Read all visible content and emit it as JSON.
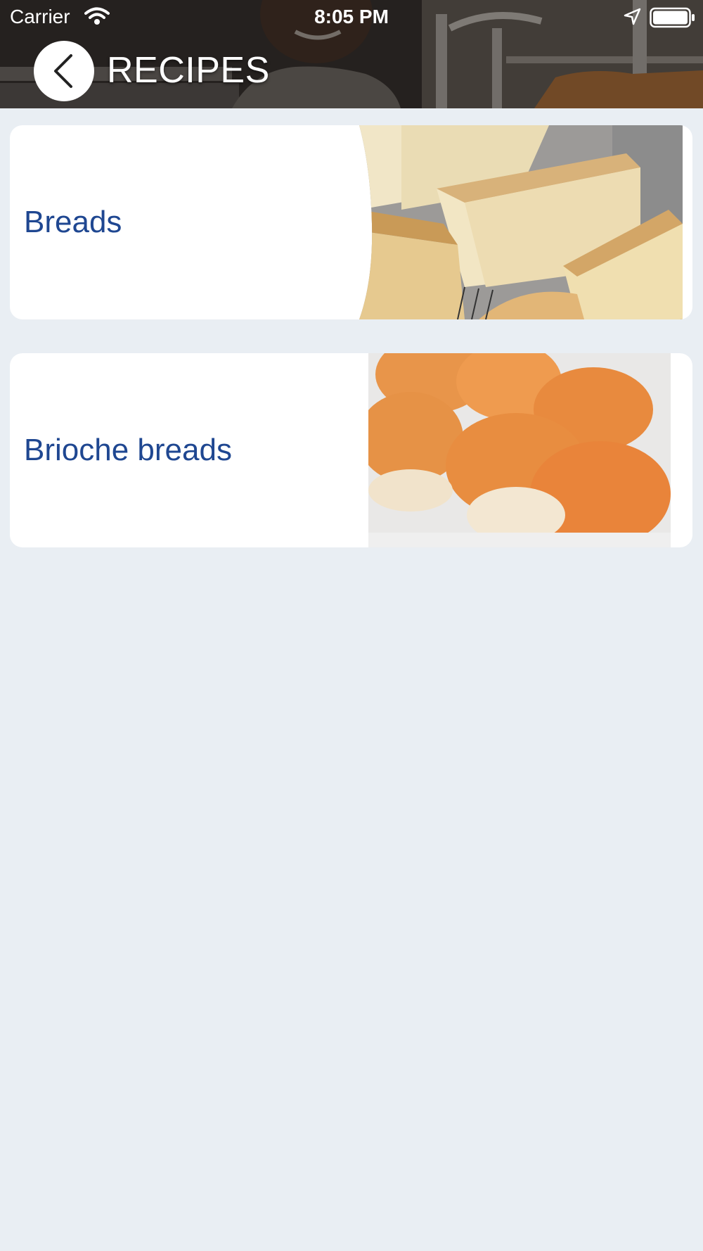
{
  "status_bar": {
    "carrier": "Carrier",
    "time": "8:05 PM"
  },
  "header": {
    "title": "RECIPES",
    "back_icon": "chevron-left-icon"
  },
  "recipes": [
    {
      "label": "Breads",
      "image": "loaves-of-bread-photo"
    },
    {
      "label": "Brioche breads",
      "image": "brioche-buns-photo"
    }
  ],
  "colors": {
    "background": "#e9eef3",
    "card": "#ffffff",
    "label": "#1f4791",
    "header_text": "#ffffff"
  }
}
